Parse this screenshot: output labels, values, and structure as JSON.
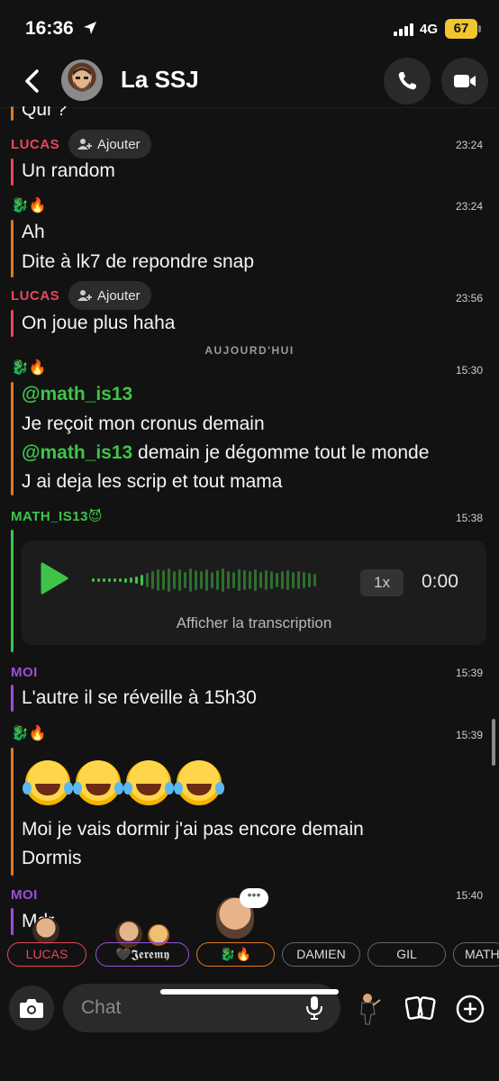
{
  "status": {
    "time": "16:36",
    "network": "4G",
    "battery": "67"
  },
  "header": {
    "title": "La SSJ"
  },
  "chat": {
    "partial_top": "Qui ?",
    "add_label": "Ajouter",
    "messages": [
      {
        "sender": "LUCAS",
        "time": "23:24",
        "lines": [
          "Un random"
        ]
      },
      {
        "sender": "🐉🔥",
        "time": "23:24",
        "lines": [
          "Ah",
          "Dite à lk7 de repondre snap"
        ]
      },
      {
        "sender": "LUCAS",
        "time": "23:56",
        "lines": [
          "On joue plus haha"
        ]
      },
      {
        "sender": "🐉🔥",
        "time": "15:30",
        "line1_mention": "@math_is13",
        "line2": "Je reçoit mon cronus demain",
        "line3_mention": "@math_is13",
        "line3_rest": " demain je dégomme tout le monde",
        "line4": "J ai deja les scrip et tout mama"
      },
      {
        "sender": "MATH_IS13😈",
        "time": "15:38",
        "voice": {
          "speed": "1x",
          "duration": "0:00",
          "transcript_label": "Afficher la transcription"
        }
      },
      {
        "sender": "MOI",
        "time": "15:39",
        "lines": [
          "L'autre il se réveille à 15h30"
        ]
      },
      {
        "sender": "🐉🔥",
        "time": "15:39",
        "lines": [
          "Moi je vais dormir j'ai pas encore demain",
          "Dormis"
        ]
      },
      {
        "sender": "MOI",
        "time": "15:40",
        "lines": [
          "Mdr"
        ]
      }
    ],
    "day_divider": "AUJOURD'HUI"
  },
  "presence": [
    "LUCAS",
    "🖤𝕵𝖊𝖗𝖊𝖒𝖞",
    "🐉🔥",
    "DAMIEN",
    "GIL",
    "MATH"
  ],
  "composer": {
    "placeholder": "Chat"
  },
  "colors": {
    "lucas": "#e8475b",
    "math": "#3fc44a",
    "moi": "#9a4fd9",
    "dragon": "#e07a20"
  }
}
